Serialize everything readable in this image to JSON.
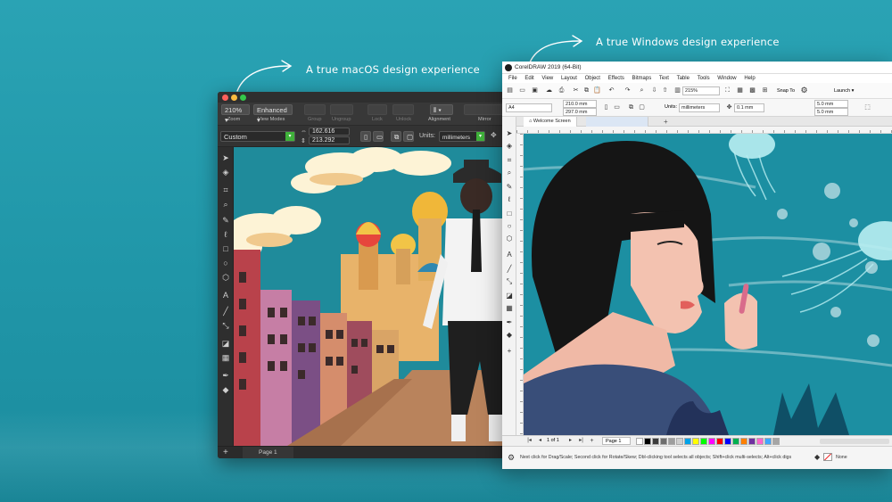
{
  "captions": {
    "mac": "A true macOS design experience",
    "win": "A true Windows design experience"
  },
  "mac": {
    "toolbar": {
      "zoom_value": "210%",
      "view_mode": "Enhanced",
      "labels": [
        "Zoom",
        "View Modes",
        "Group",
        "Ungroup",
        "Lock",
        "Unlock",
        "Alignment",
        "Mirror"
      ]
    },
    "property_bar": {
      "preset": "Custom",
      "width": "162.616",
      "height": "213.292",
      "units_label": "Units:",
      "units_value": "millimeters"
    },
    "status": {
      "page_label": "Page 1",
      "add_icon": "plus-icon"
    }
  },
  "win": {
    "title": "CorelDRAW 2019 (64-Bit)",
    "menu": [
      "File",
      "Edit",
      "View",
      "Layout",
      "Object",
      "Effects",
      "Bitmaps",
      "Text",
      "Table",
      "Tools",
      "Window",
      "Help"
    ],
    "toolbar": {
      "zoom": "215%",
      "snap": "Snap To",
      "launch": "Launch"
    },
    "property_bar": {
      "page_size": "A4",
      "width": "210.0 mm",
      "height": "297.0 mm",
      "units_label": "Units:",
      "units_value": "millimeters",
      "nudge": "0.1 mm",
      "dup_x": "5.0 mm",
      "dup_y": "5.0 mm"
    },
    "tabs": {
      "welcome": "Welcome Screen"
    },
    "pagebar": {
      "counter": "1 of 1",
      "page": "Page 1"
    },
    "status": {
      "hint": "Next click for Drag/Scale; Second click for Rotate/Skew; Dbl-clicking tool selects all objects; Shift+click multi-selects; Alt+click digs",
      "fill": "None"
    },
    "palette": [
      "#ffffff",
      "#000000",
      "#3c3c3c",
      "#6e6e6e",
      "#9e9e9e",
      "#cfcfcf",
      "#00a2e8",
      "#ffff00",
      "#00ff00",
      "#ff00ff",
      "#ff0000",
      "#0000ff",
      "#00b050",
      "#ff7f00",
      "#7030a0",
      "#ff66cc",
      "#3fa7ff",
      "#a5a5a5"
    ]
  }
}
